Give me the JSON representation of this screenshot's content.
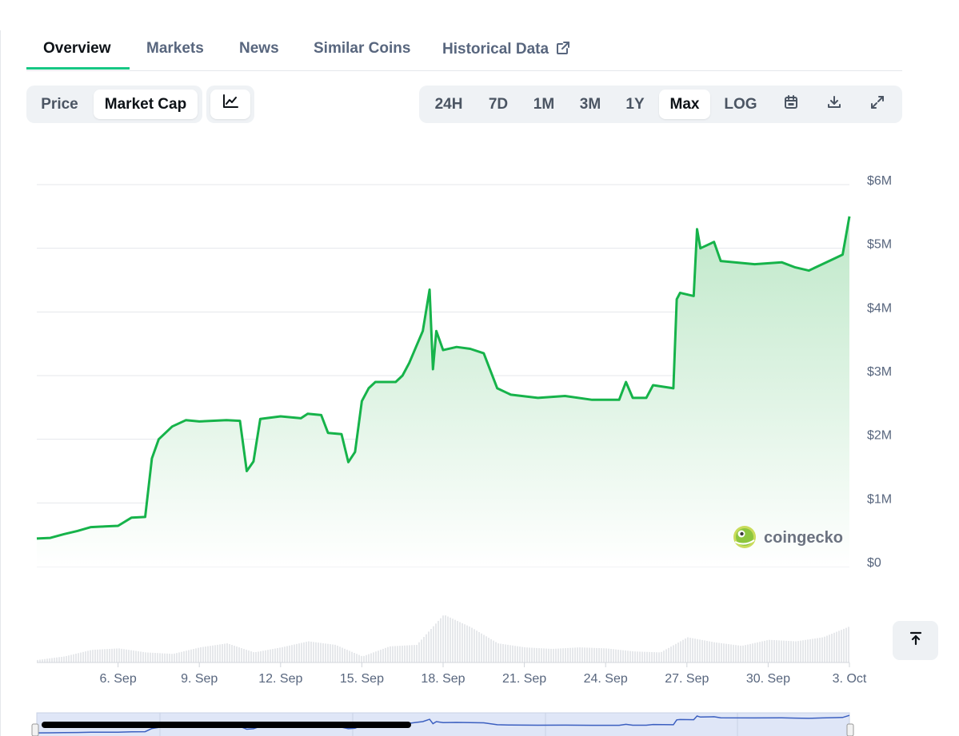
{
  "tabs": [
    {
      "label": "Overview",
      "active": true
    },
    {
      "label": "Markets",
      "active": false
    },
    {
      "label": "News",
      "active": false
    },
    {
      "label": "Similar Coins",
      "active": false
    },
    {
      "label": "Historical Data",
      "active": false,
      "icon": "external-link-icon"
    }
  ],
  "metric_toggle": {
    "options": [
      "Price",
      "Market Cap"
    ],
    "selected": "Market Cap"
  },
  "chart_type_icon": "line-chart-icon",
  "ranges": {
    "options": [
      "24H",
      "7D",
      "1M",
      "3M",
      "1Y",
      "Max",
      "LOG"
    ],
    "selected": "Max"
  },
  "toolbar_icons": [
    "calendar-icon",
    "download-icon",
    "expand-icon"
  ],
  "watermark": "coingecko",
  "scroll_top_icon": "arrow-to-top-icon",
  "colors": {
    "line": "#16b34a",
    "fill_top": "#bfe8c9",
    "accent": "#16c784",
    "volume": "#e6e8eb",
    "navigator_line": "#3b5fc0"
  },
  "chart_data": {
    "type": "area",
    "series": [
      {
        "values_unit": "USD market cap",
        "points": [
          [
            "2024-09-03 00:00",
            440000
          ],
          [
            "2024-09-03 12:00",
            450000
          ],
          [
            "2024-09-04 00:00",
            510000
          ],
          [
            "2024-09-04 12:00",
            560000
          ],
          [
            "2024-09-05 00:00",
            620000
          ],
          [
            "2024-09-05 12:00",
            630000
          ],
          [
            "2024-09-06 00:00",
            640000
          ],
          [
            "2024-09-06 12:00",
            770000
          ],
          [
            "2024-09-07 00:00",
            780000
          ],
          [
            "2024-09-07 06:00",
            1700000
          ],
          [
            "2024-09-07 12:00",
            2000000
          ],
          [
            "2024-09-08 00:00",
            2200000
          ],
          [
            "2024-09-08 12:00",
            2300000
          ],
          [
            "2024-09-09 00:00",
            2280000
          ],
          [
            "2024-09-10 00:00",
            2300000
          ],
          [
            "2024-09-10 12:00",
            2290000
          ],
          [
            "2024-09-10 18:00",
            1500000
          ],
          [
            "2024-09-11 00:00",
            1650000
          ],
          [
            "2024-09-11 06:00",
            2320000
          ],
          [
            "2024-09-12 00:00",
            2360000
          ],
          [
            "2024-09-12 18:00",
            2330000
          ],
          [
            "2024-09-13 00:00",
            2400000
          ],
          [
            "2024-09-13 12:00",
            2380000
          ],
          [
            "2024-09-13 18:00",
            2100000
          ],
          [
            "2024-09-14 06:00",
            2080000
          ],
          [
            "2024-09-14 12:00",
            1640000
          ],
          [
            "2024-09-14 18:00",
            1800000
          ],
          [
            "2024-09-15 00:00",
            2600000
          ],
          [
            "2024-09-15 06:00",
            2800000
          ],
          [
            "2024-09-15 12:00",
            2900000
          ],
          [
            "2024-09-16 06:00",
            2900000
          ],
          [
            "2024-09-16 12:00",
            3000000
          ],
          [
            "2024-09-16 18:00",
            3200000
          ],
          [
            "2024-09-17 00:00",
            3450000
          ],
          [
            "2024-09-17 06:00",
            3700000
          ],
          [
            "2024-09-17 12:00",
            4350000
          ],
          [
            "2024-09-17 15:00",
            3100000
          ],
          [
            "2024-09-17 18:00",
            3700000
          ],
          [
            "2024-09-18 00:00",
            3400000
          ],
          [
            "2024-09-18 12:00",
            3450000
          ],
          [
            "2024-09-19 00:00",
            3420000
          ],
          [
            "2024-09-19 12:00",
            3350000
          ],
          [
            "2024-09-20 00:00",
            2800000
          ],
          [
            "2024-09-20 12:00",
            2700000
          ],
          [
            "2024-09-21 12:00",
            2650000
          ],
          [
            "2024-09-22 12:00",
            2680000
          ],
          [
            "2024-09-23 12:00",
            2620000
          ],
          [
            "2024-09-24 12:00",
            2620000
          ],
          [
            "2024-09-24 18:00",
            2900000
          ],
          [
            "2024-09-25 00:00",
            2650000
          ],
          [
            "2024-09-25 12:00",
            2650000
          ],
          [
            "2024-09-25 18:00",
            2850000
          ],
          [
            "2024-09-26 12:00",
            2800000
          ],
          [
            "2024-09-26 15:00",
            4200000
          ],
          [
            "2024-09-26 18:00",
            4300000
          ],
          [
            "2024-09-27 06:00",
            4250000
          ],
          [
            "2024-09-27 09:00",
            5300000
          ],
          [
            "2024-09-27 12:00",
            5000000
          ],
          [
            "2024-09-28 00:00",
            5100000
          ],
          [
            "2024-09-28 06:00",
            4800000
          ],
          [
            "2024-09-29 12:00",
            4750000
          ],
          [
            "2024-09-30 12:00",
            4780000
          ],
          [
            "2024-10-01 00:00",
            4700000
          ],
          [
            "2024-10-01 12:00",
            4650000
          ],
          [
            "2024-10-02 00:00",
            4750000
          ],
          [
            "2024-10-02 12:00",
            4850000
          ],
          [
            "2024-10-02 18:00",
            4900000
          ],
          [
            "2024-10-03 00:00",
            5500000
          ]
        ]
      }
    ],
    "volume": {
      "points": [
        [
          "2024-09-03 00:00",
          0.05
        ],
        [
          "2024-09-04 00:00",
          0.12
        ],
        [
          "2024-09-05 00:00",
          0.25
        ],
        [
          "2024-09-06 00:00",
          0.28
        ],
        [
          "2024-09-07 00:00",
          0.2
        ],
        [
          "2024-09-08 00:00",
          0.17
        ],
        [
          "2024-09-09 00:00",
          0.3
        ],
        [
          "2024-09-10 00:00",
          0.38
        ],
        [
          "2024-09-11 00:00",
          0.2
        ],
        [
          "2024-09-12 00:00",
          0.3
        ],
        [
          "2024-09-13 00:00",
          0.42
        ],
        [
          "2024-09-14 00:00",
          0.35
        ],
        [
          "2024-09-15 00:00",
          0.12
        ],
        [
          "2024-09-16 00:00",
          0.32
        ],
        [
          "2024-09-17 00:00",
          0.35
        ],
        [
          "2024-09-18 00:00",
          0.95
        ],
        [
          "2024-09-19 00:00",
          0.7
        ],
        [
          "2024-09-20 00:00",
          0.38
        ],
        [
          "2024-09-21 00:00",
          0.3
        ],
        [
          "2024-09-22 00:00",
          0.27
        ],
        [
          "2024-09-23 00:00",
          0.3
        ],
        [
          "2024-09-24 00:00",
          0.28
        ],
        [
          "2024-09-25 00:00",
          0.22
        ],
        [
          "2024-09-26 00:00",
          0.2
        ],
        [
          "2024-09-27 00:00",
          0.5
        ],
        [
          "2024-09-28 00:00",
          0.4
        ],
        [
          "2024-09-29 00:00",
          0.33
        ],
        [
          "2024-09-30 00:00",
          0.45
        ],
        [
          "2024-10-01 00:00",
          0.42
        ],
        [
          "2024-10-02 00:00",
          0.5
        ],
        [
          "2024-10-03 00:00",
          0.72
        ]
      ]
    },
    "x_ticks": [
      {
        "label": "6. Sep",
        "date": "2024-09-06"
      },
      {
        "label": "9. Sep",
        "date": "2024-09-09"
      },
      {
        "label": "12. Sep",
        "date": "2024-09-12"
      },
      {
        "label": "15. Sep",
        "date": "2024-09-15"
      },
      {
        "label": "18. Sep",
        "date": "2024-09-18"
      },
      {
        "label": "21. Sep",
        "date": "2024-09-21"
      },
      {
        "label": "24. Sep",
        "date": "2024-09-24"
      },
      {
        "label": "27. Sep",
        "date": "2024-09-27"
      },
      {
        "label": "30. Sep",
        "date": "2024-09-30"
      },
      {
        "label": "3. Oct",
        "date": "2024-10-03"
      }
    ],
    "y_ticks": [
      {
        "label": "$0",
        "value": 0
      },
      {
        "label": "$1M",
        "value": 1000000
      },
      {
        "label": "$2M",
        "value": 2000000
      },
      {
        "label": "$3M",
        "value": 3000000
      },
      {
        "label": "$4M",
        "value": 4000000
      },
      {
        "label": "$5M",
        "value": 5000000
      },
      {
        "label": "$6M",
        "value": 6000000
      }
    ],
    "ylim": [
      0,
      6000000
    ],
    "xlim": [
      "2024-09-03 00:00",
      "2024-10-03 00:00"
    ],
    "grid": true,
    "y_axis_side": "right"
  }
}
